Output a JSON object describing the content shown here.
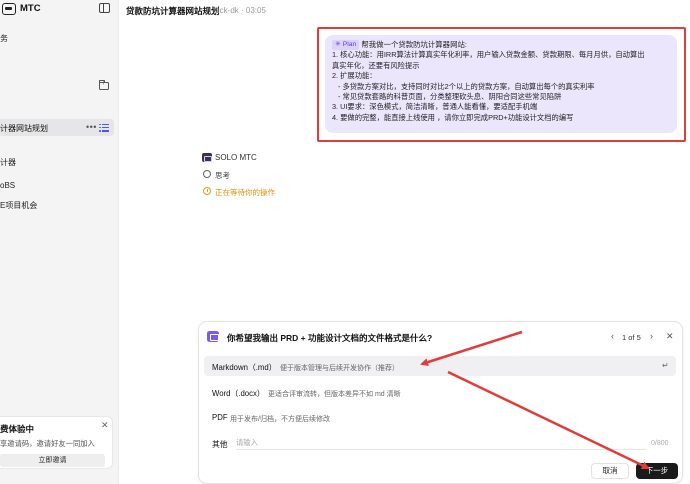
{
  "sidebar": {
    "brand": "MTC",
    "items": [
      {
        "label": "务"
      },
      {
        "label": "计器网站规划",
        "active": true
      },
      {
        "label": "计器"
      },
      {
        "label": "oBS"
      },
      {
        "label": "E项目机会"
      }
    ],
    "invite": {
      "title": "费体验中",
      "desc": "享邀请码，邀请好友一同加入",
      "button": "立即邀请"
    }
  },
  "header": {
    "title": "贷款防坑计算器网站规划",
    "meta": "fuck-dk · 03:05"
  },
  "user_message": {
    "tag": "Plan",
    "lines": [
      "帮我做一个贷款防坑计算器网站:",
      "1. 核心功能：用IRR算法计算真实年化利率，用户输入贷款金额、贷款期限、每月月供，自动算出",
      "真实年化，还要有风险提示",
      "2. 扩展功能：",
      "   - 多贷款方案对比，支持同时对比2个以上的贷款方案，自动算出每个的真实利率",
      "   - 常见贷款套路的科普页面，分类整理砍头息、阴阳合同这些常见陷阱",
      "3. UI要求：深色模式，简洁清晰，普通人能看懂，要适配手机端",
      "4. 要做的完整，能直接上线使用 ，请你立即完成PRD+功能设计文档的编写"
    ]
  },
  "assistant": {
    "name": "SOLO MTC",
    "thinking": "思考",
    "waiting": "正在等待你的操作"
  },
  "question": {
    "title": "你希望我输出 PRD + 功能设计文档的文件格式是什么?",
    "counter": "1 of 5",
    "options": [
      {
        "label": "Markdown（.md）",
        "desc": "便于版本管理与后续开发协作（推荐）",
        "selected": true
      },
      {
        "label": "Word（.docx）",
        "desc": "更适合评审流转，但版本差异不如 md 清晰"
      },
      {
        "label": "PDF",
        "desc": "用于发布/归档，不方便后续修改"
      }
    ],
    "other": {
      "label": "其他",
      "placeholder": "请输入",
      "count": "0/800"
    },
    "cancel": "取消",
    "next": "下一步"
  },
  "colors": {
    "annotation": "#e23b3b",
    "plan_bubble": "#ece6fd",
    "accent": "#7a5af5",
    "waiting": "#e0900f"
  }
}
